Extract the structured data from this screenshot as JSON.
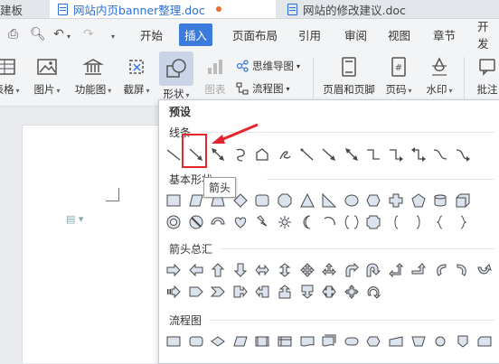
{
  "tabs": [
    {
      "title": "建板"
    },
    {
      "title": "网站内页banner整理.doc"
    },
    {
      "title": "网站的修改建议.doc"
    }
  ],
  "menu": {
    "items": [
      "开始",
      "插入",
      "页面布局",
      "引用",
      "审阅",
      "视图",
      "章节",
      "开发"
    ],
    "active": "插入"
  },
  "toolbar": {
    "table": "表格",
    "picture": "图片",
    "function_chart": "功能图",
    "screenshot": "截屏",
    "shape": "形状",
    "chart": "图表",
    "mindmap": "思维导图",
    "flowchart": "流程图",
    "header_footer": "页眉和页脚",
    "page_number": "页码",
    "watermark": "水印",
    "comment": "批注"
  },
  "panel": {
    "heading": "预设",
    "sections": {
      "lines": "线条",
      "basic_shapes": "基本形状",
      "arrows": "箭头总汇",
      "flowchart": "流程图"
    },
    "tooltip": "箭头"
  },
  "colors": {
    "accent": "#3a7bdc",
    "highlight_red": "#e4252b",
    "icon_blue": "#2b6fd6"
  }
}
